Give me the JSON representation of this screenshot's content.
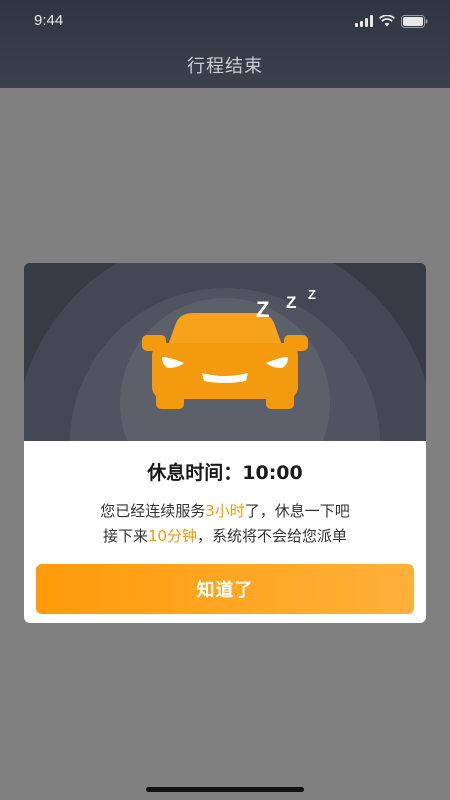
{
  "status_bar": {
    "time": "9:44"
  },
  "nav": {
    "title": "行程结束"
  },
  "dialog": {
    "illustration": {
      "zzz": [
        "Z",
        "Z",
        "Z"
      ],
      "icon": "sleeping-car-icon"
    },
    "rest_label": "休息时间：",
    "rest_time": "10:00",
    "line1": {
      "before": "您已经连续服务",
      "highlight": "3小时",
      "after": "了，休息一下吧"
    },
    "line2": {
      "before": "接下来",
      "highlight": "10分钟",
      "after": "，系统将不会给您派单"
    },
    "confirm_label": "知道了"
  },
  "colors": {
    "accent": "#f59a0c",
    "button_start": "#ff9b0a",
    "button_end": "#ffb03a",
    "overlay": "#808080",
    "topbar": "#2f3541"
  }
}
